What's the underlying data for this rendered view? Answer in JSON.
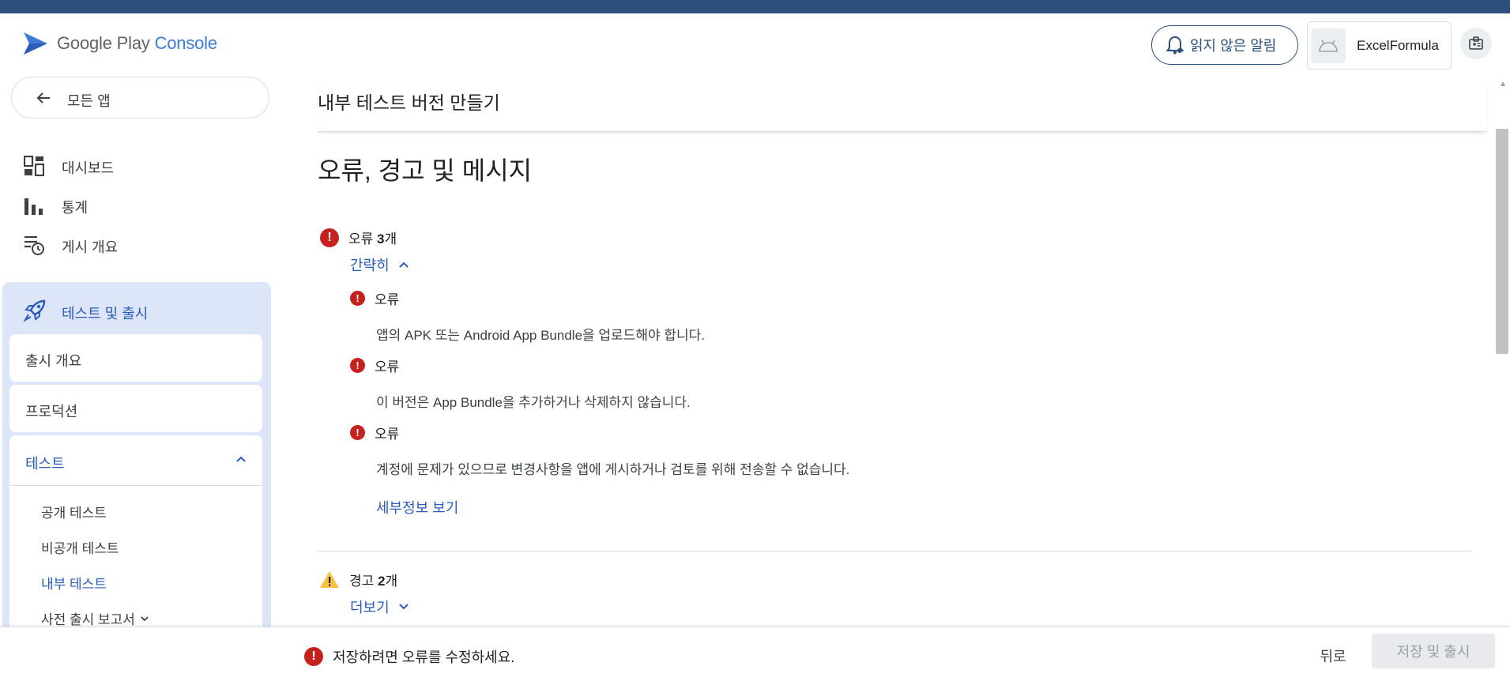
{
  "header": {
    "brand_main": "Google Play",
    "brand_accent": "Console",
    "notifications_label": "읽지 않은 알림",
    "account_name": "ExcelFormula"
  },
  "sidebar": {
    "back_label": "모든 앱",
    "items": [
      {
        "label": "대시보드",
        "icon": "dashboard-icon"
      },
      {
        "label": "통계",
        "icon": "bar-chart-icon"
      },
      {
        "label": "게시 개요",
        "icon": "publishing-overview-icon"
      }
    ],
    "release": {
      "label": "테스트 및 출시",
      "icon": "rocket-icon",
      "cards": [
        {
          "label": "출시 개요"
        },
        {
          "label": "프로덕션"
        }
      ],
      "testing": {
        "label": "테스트",
        "subitems": [
          {
            "label": "공개 테스트"
          },
          {
            "label": "비공개 테스트"
          },
          {
            "label": "내부 테스트"
          },
          {
            "label": "사전 출시 보고서"
          }
        ]
      }
    }
  },
  "main": {
    "page_title": "내부 테스트 버전 만들기",
    "section_title": "오류, 경고 및 메시지",
    "errors": {
      "heading_prefix": "오류 ",
      "count": "3",
      "heading_suffix": "개",
      "toggle_label": "간략히",
      "items": [
        {
          "label": "오류",
          "message": "앱의 APK 또는 Android App Bundle을 업로드해야 합니다."
        },
        {
          "label": "오류",
          "message": "이 버전은 App Bundle을 추가하거나 삭제하지 않습니다."
        },
        {
          "label": "오류",
          "message": "계정에 문제가 있으므로 변경사항을 앱에 게시하거나 검토를 위해 전송할 수 없습니다."
        }
      ],
      "details_link": "세부정보 보기"
    },
    "warnings": {
      "heading_prefix": "경고 ",
      "count": "2",
      "heading_suffix": "개",
      "toggle_label": "더보기"
    }
  },
  "footer": {
    "message": "저장하려면 오류를 수정하세요.",
    "back_label": "뒤로",
    "save_label": "저장 및 출시"
  },
  "colors": {
    "top_bar": "#2d4f7c",
    "accent": "#2d5bb8",
    "error": "#c5221f",
    "warning": "#f5c242",
    "panel": "#dce6f8"
  }
}
